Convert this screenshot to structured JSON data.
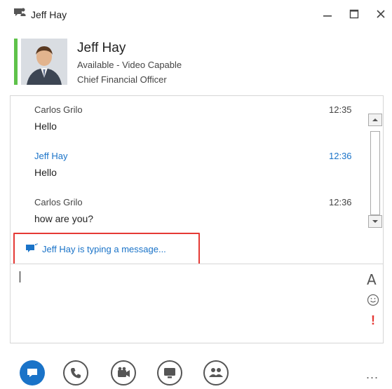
{
  "window": {
    "title": "Jeff Hay",
    "controls": [
      "minimize-icon",
      "maximize-icon",
      "close-icon"
    ]
  },
  "contact": {
    "name": "Jeff Hay",
    "status": "Available - Video Capable",
    "job_title": "Chief Financial Officer",
    "presence_color": "#5ec24a"
  },
  "conversation": {
    "messages": [
      {
        "sender": "Carlos Grilo",
        "text": "Hello",
        "time": "12:35"
      },
      {
        "sender": "Jeff Hay",
        "text": "Hello",
        "time": "12:36"
      },
      {
        "sender": "Carlos Grilo",
        "text": "how are you?",
        "time": "12:36"
      }
    ],
    "typing_indicator": "Jeff Hay is typing a message..."
  },
  "compose": {
    "font_button": "A",
    "emoji_icon": "smiley-icon",
    "important_button": "!"
  },
  "bottom_bar": {
    "buttons": [
      "im-icon",
      "phone-icon",
      "video-icon",
      "present-icon",
      "people-icon"
    ],
    "more_label": "..."
  },
  "colors": {
    "accent": "#1a73c8",
    "highlight": "#e53935",
    "presence": "#5ec24a"
  }
}
